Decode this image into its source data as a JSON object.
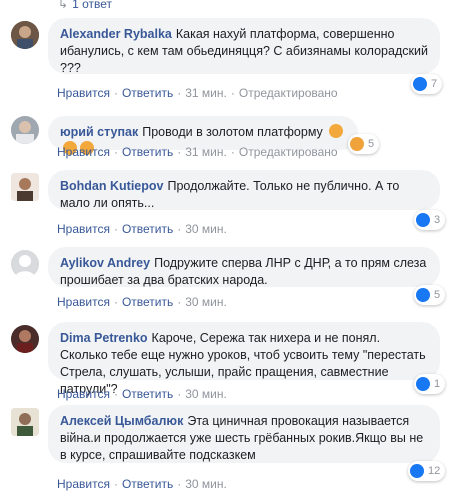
{
  "reply_count": "1 ответ",
  "action_labels": {
    "like": "Нравится",
    "reply": "Ответить"
  },
  "colors": {
    "link": "#385898",
    "bubble": "#f2f3f5",
    "meta": "#90949c",
    "like": "#1877f2",
    "angry": "#f0a23b"
  },
  "comments": [
    {
      "author": "Alexander Rybalka",
      "text": "Какая нахуй платформа, совершенно ибанулись, с кем там обьединяцця? С абизянамы колорадский ???",
      "time": "31 мин.",
      "edited": "Отредактировано",
      "reactions": {
        "icon": "like-icon",
        "count": "7"
      }
    },
    {
      "author": "юрий ступак",
      "text": "Проводи в золотом платформу",
      "emoji": [
        "angry-emoji",
        "angry-emoji",
        "angry-emoji"
      ],
      "time": "31 мин.",
      "edited": "Отредактировано",
      "reactions": {
        "icon": "angry-icon",
        "count": "5"
      }
    },
    {
      "author": "Bohdan Kutiepov",
      "text": "Продолжайте. Только не публично. А то мало ли опять...",
      "time": "30 мин.",
      "reactions": {
        "icon": "like-icon",
        "count": "3"
      }
    },
    {
      "author": "Aylikov Andrey",
      "text": "Подружите сперва ЛНР с ДНР, а то прям слеза прошибает за два братских народа.",
      "time": "30 мин.",
      "reactions": {
        "icon": "like-icon",
        "count": "5"
      }
    },
    {
      "author": "Dima Petrenko",
      "text": "Кароче, Сережа так нихера и не понял. Сколько тебе еще нужно уроков, чтоб усвоить тему \"перестать Стрела, слушать, услыши, прайс пращения, савместние патрули\"?",
      "time": "30 мин.",
      "reactions": {
        "icon": "like-icon",
        "count": "1"
      }
    },
    {
      "author": "Алексей Цымбалюк",
      "text": "Эта циничная провокация называется війна.и продолжается уже шесть грёбанных рокив.Якщо вы не в курсе, спрашивайте подсказкем",
      "time": "30 мин.",
      "reactions": {
        "icon": "like-icon",
        "count": "12"
      }
    }
  ]
}
